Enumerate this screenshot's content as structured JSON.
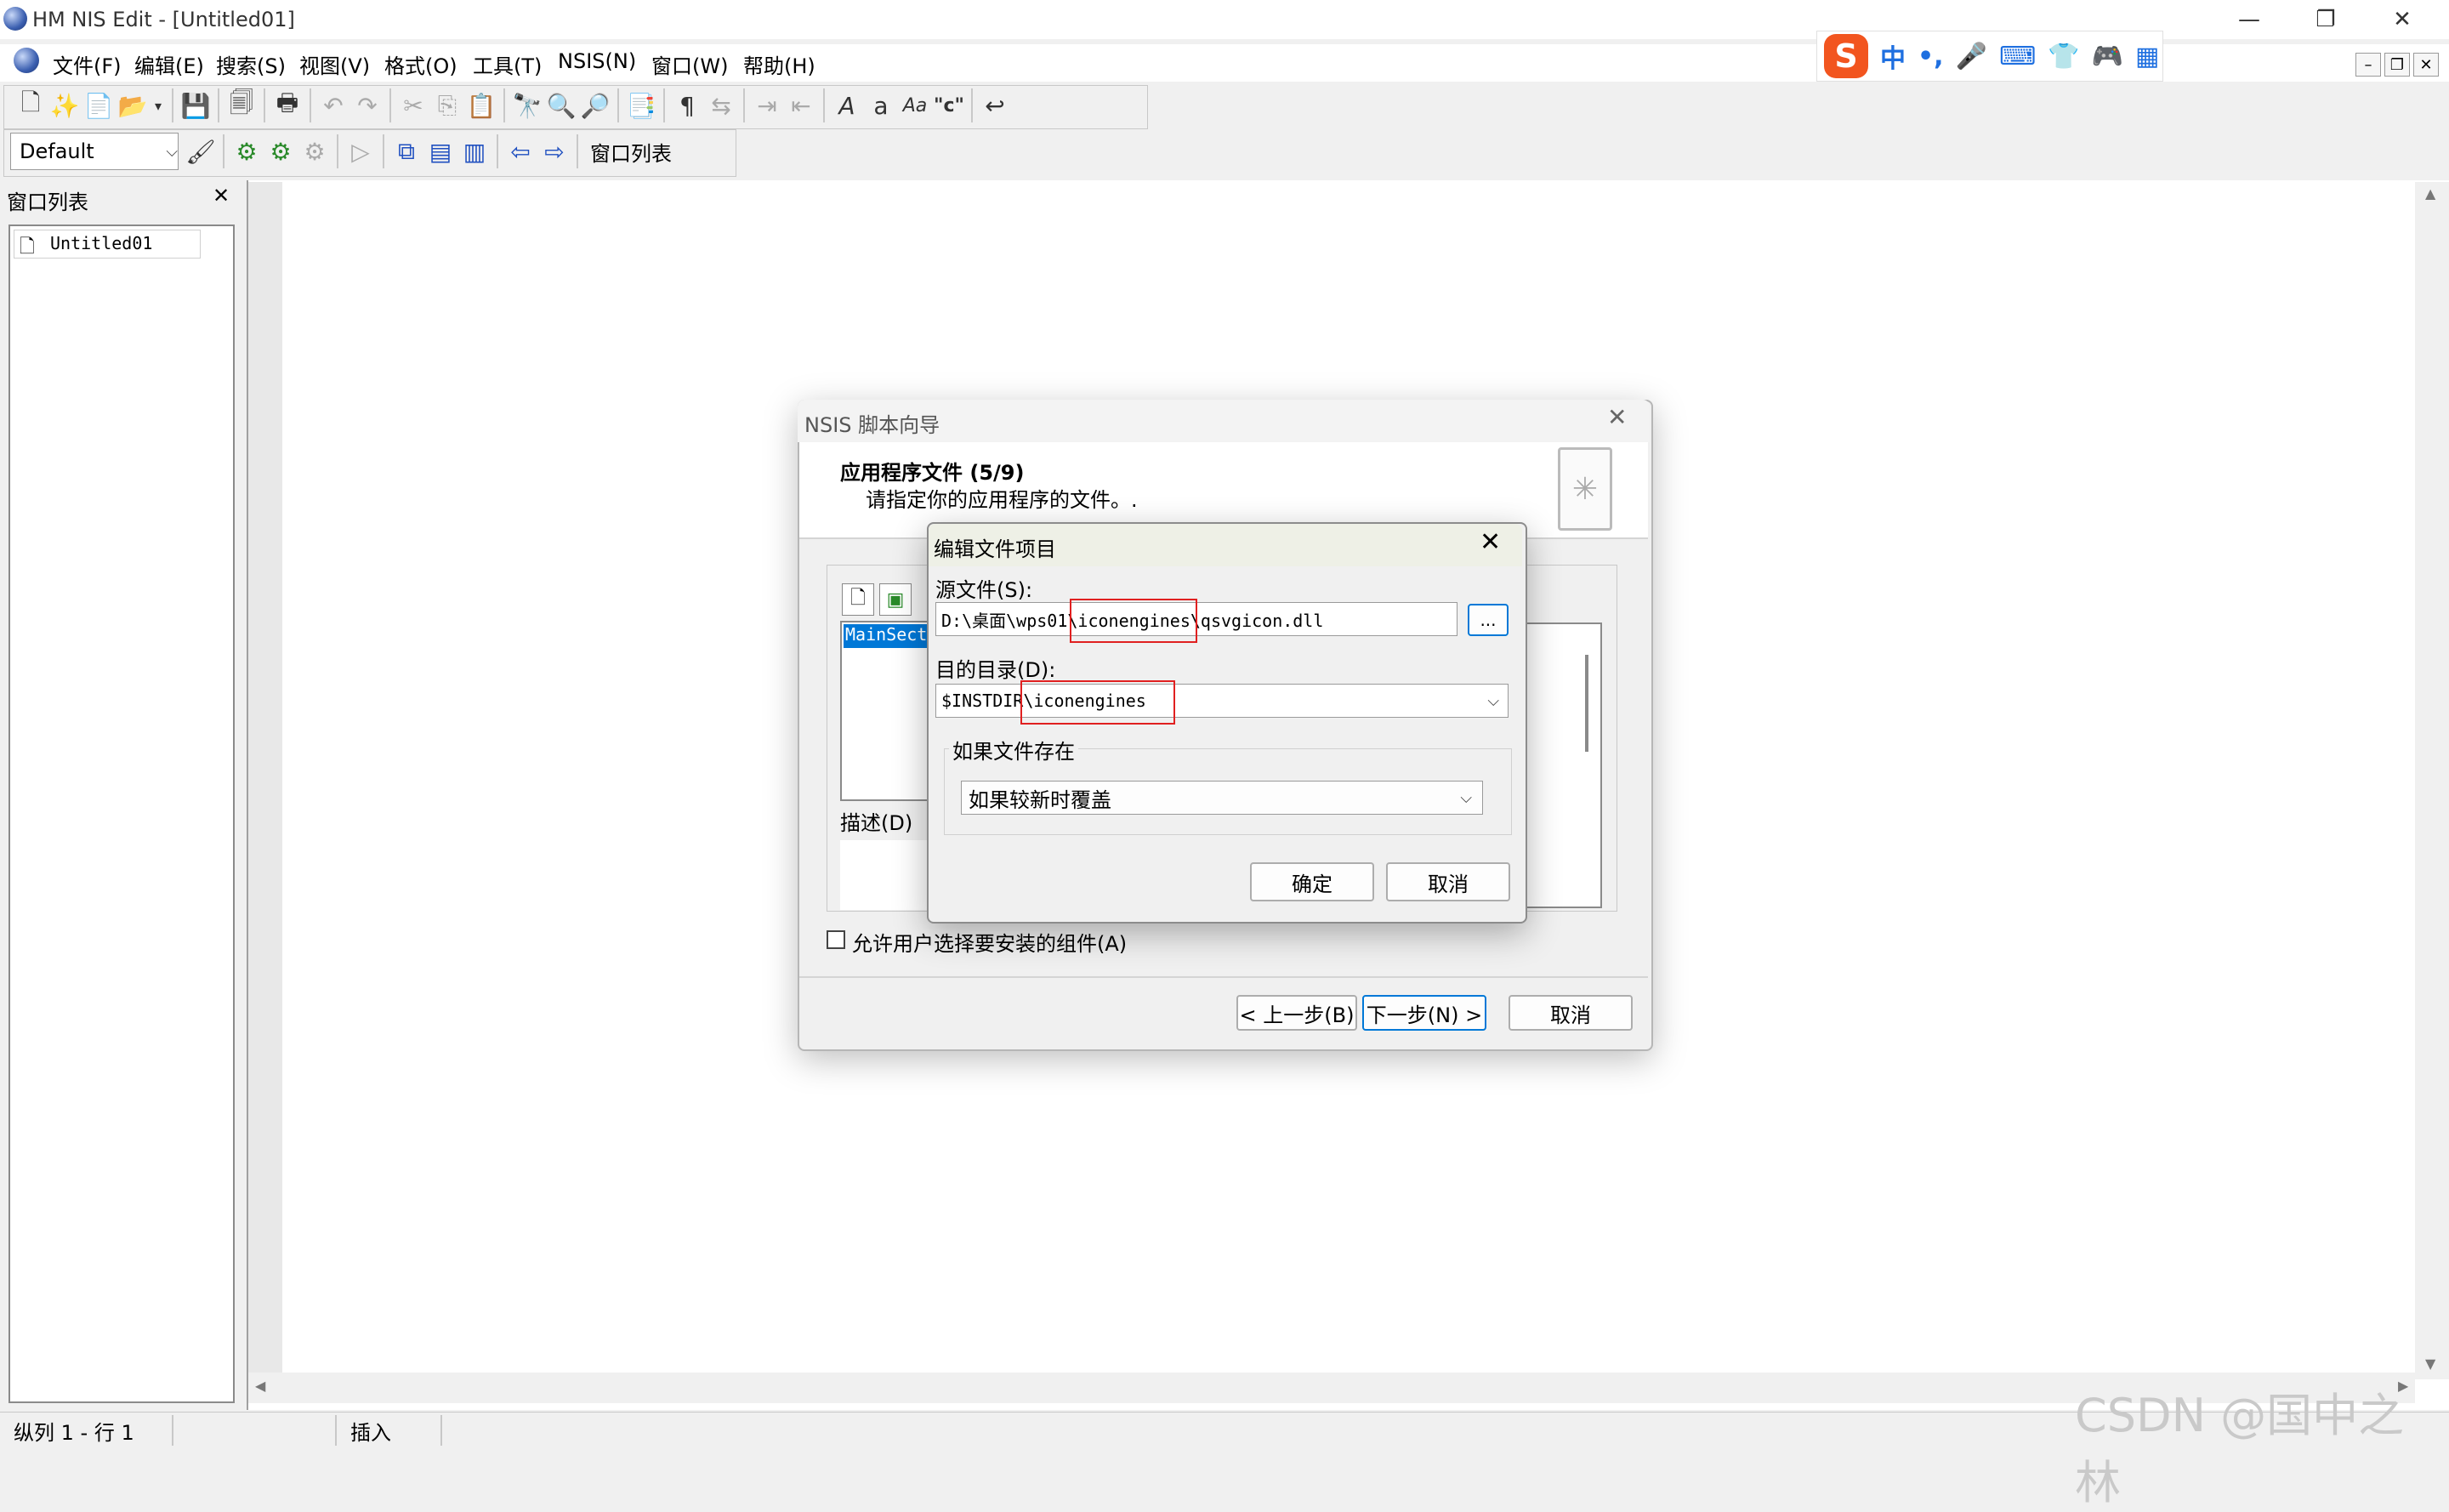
{
  "app": {
    "title": "HM NIS Edit - [Untitled01]"
  },
  "window_controls": {
    "minimize": "—",
    "restore": "❐",
    "close": "✕"
  },
  "menu": [
    "文件(F)",
    "编辑(E)",
    "搜索(S)",
    "视图(V)",
    "格式(O)",
    "工具(T)",
    "NSIS(N)",
    "窗口(W)",
    "帮助(H)"
  ],
  "ime": {
    "logo": "S",
    "lang": "中",
    "punct": "•,"
  },
  "mdi_controls": {
    "minimize": "–",
    "restore": "❐",
    "close": "✕"
  },
  "toolbar2": {
    "style_value": "Default",
    "window_list_label": "窗口列表"
  },
  "panel": {
    "title": "窗口列表",
    "close": "✕",
    "files": [
      "Untitled01"
    ]
  },
  "status": {
    "position": "纵列 1 - 行 1",
    "mode": "插入"
  },
  "watermark": "CSDN @国中之林",
  "wizard": {
    "title": "NSIS 脚本向导",
    "heading": "应用程序文件 (5/9)",
    "subheading": "请指定你的应用程序的文件。.",
    "section_item": "MainSect",
    "desc_label": "描述(D)",
    "allow_select_label": "允许用户选择要安装的组件(A)",
    "back_button": "< 上一步(B)",
    "next_button": "下一步(N) >",
    "cancel_button": "取消"
  },
  "edit_dialog": {
    "title": "编辑文件项目",
    "source_label": "源文件(S):",
    "source_value": "D:\\桌面\\wps01\\iconengines\\qsvgicon.dll",
    "browse_button": "...",
    "dest_label": "目的目录(D):",
    "dest_value": "$INSTDIR\\iconengines",
    "group_label": "如果文件存在",
    "overwrite_value": "如果较新时覆盖",
    "ok_button": "确定",
    "cancel_button": "取消"
  }
}
